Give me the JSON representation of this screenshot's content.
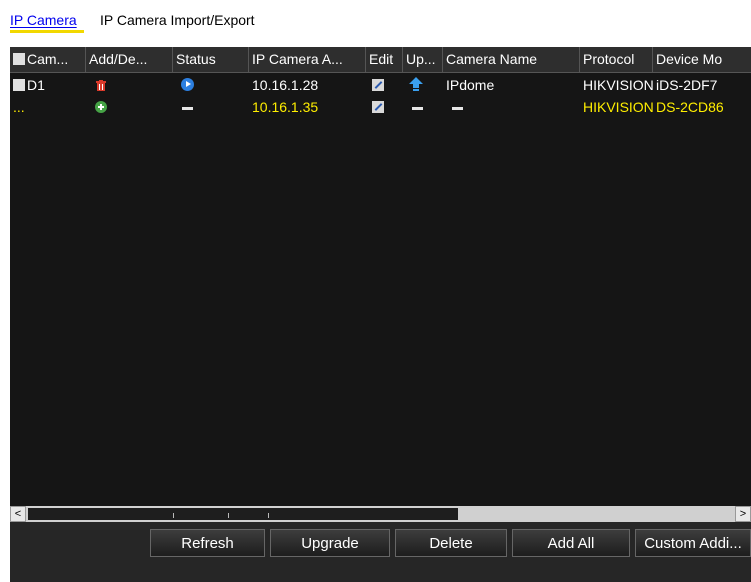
{
  "tabs": [
    {
      "label": "IP Camera",
      "active": true
    },
    {
      "label": "IP Camera Import/Export",
      "active": false
    }
  ],
  "table": {
    "headers": [
      "Cam...",
      "Add/De...",
      "Status",
      "IP Camera A...",
      "Edit",
      "Up...",
      "Camera Name",
      "Protocol",
      "Device Mo"
    ],
    "rows": [
      {
        "camera": "D1",
        "add_delete_icon": "trash-icon",
        "status_icon": "play-icon",
        "ip": "10.16.1.28",
        "edit_icon": "edit-icon",
        "upgrade_icon": "upgrade-icon",
        "camera_name": "IPdome",
        "protocol": "HIKVISION",
        "device_model": "iDS-2DF7"
      },
      {
        "camera": "...",
        "add_delete_icon": "add-icon",
        "status": "–",
        "ip": "10.16.1.35",
        "edit_icon": "edit-icon",
        "upgrade": "–",
        "camera_name": "–",
        "protocol": "HIKVISION",
        "device_model": "DS-2CD86"
      }
    ]
  },
  "buttons": {
    "refresh": "Refresh",
    "upgrade": "Upgrade",
    "delete": "Delete",
    "add_all": "Add All",
    "custom_add": "Custom Addi..."
  },
  "scrollbar": {
    "left": "<",
    "right": ">"
  },
  "colors": {
    "selected_row_text": "#ffee00",
    "tab_underline": "#f2d800",
    "panel_bg": "#151515"
  }
}
